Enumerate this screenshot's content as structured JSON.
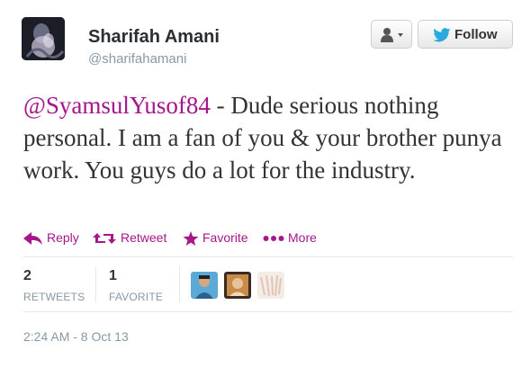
{
  "author": {
    "name": "Sharifah Amani",
    "handle": "@sharifahamani"
  },
  "header": {
    "follow_label": "Follow",
    "user_menu_icon": "user-dropdown-icon",
    "follow_icon": "twitter-bird-icon"
  },
  "tweet": {
    "mention": "@SyamsulYusof84",
    "body": " - Dude serious nothing personal. I am a fan of you & your brother punya work. You guys do a lot for the industry."
  },
  "actions": {
    "reply": "Reply",
    "retweet": "Retweet",
    "favorite": "Favorite",
    "more": "More"
  },
  "stats": {
    "retweets_count": "2",
    "retweets_label": "RETWEETS",
    "favorites_count": "1",
    "favorites_label": "FAVORITE"
  },
  "footer": {
    "timestamp": "2:24 AM - 8 Oct 13"
  },
  "colors": {
    "accent": "#a6168b",
    "twitter_blue": "#2aa9e0",
    "muted": "#8899a6"
  }
}
